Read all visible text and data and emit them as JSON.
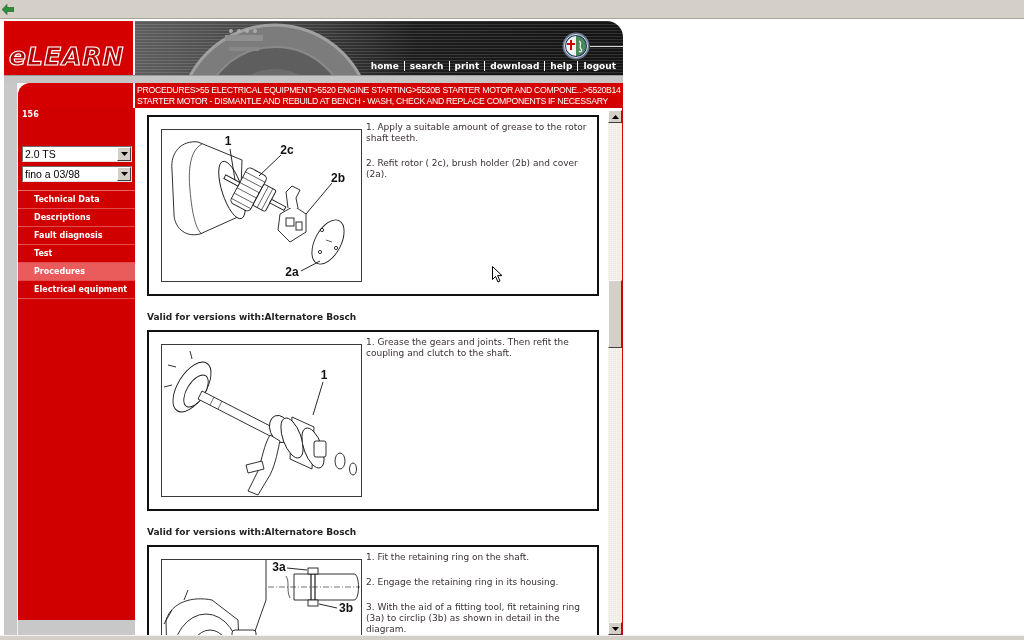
{
  "header": {
    "logo": "eLEARN",
    "nav_links": [
      "home",
      "search",
      "print",
      "download",
      "help",
      "logout"
    ]
  },
  "breadcrumb": {
    "lines": [
      "PROCEDURES>55 ELECTRICAL EQUIPMENT>5520 ENGINE STARTING>5520B STARTER MOTOR AND COMPONE...>5520B14",
      "STARTER MOTOR - DISMANTLE AND REBUILD AT BENCH - WASH, CHECK AND REPLACE COMPONENTS IF NECESSARY"
    ]
  },
  "sidebar": {
    "model": "156",
    "selects": [
      "2.0 TS",
      "fino a 03/98"
    ],
    "items": [
      {
        "label": "Technical Data",
        "selected": false
      },
      {
        "label": "Descriptions",
        "selected": false
      },
      {
        "label": "Fault diagnosis",
        "selected": false
      },
      {
        "label": "Test",
        "selected": false
      },
      {
        "label": "Procedures",
        "selected": true
      },
      {
        "label": "Electrical equipment",
        "selected": false
      }
    ]
  },
  "content": {
    "sections": [
      {
        "diagram": {
          "kind": "rotor-assembly",
          "callouts": [
            "1",
            "2c",
            "2b",
            "2a"
          ]
        },
        "steps": [
          "1. Apply a suitable amount of grease to the rotor shaft teeth.",
          "2. Refit rotor ( 2c), brush holder (2b) and cover (2a)."
        ]
      },
      {
        "heading": "Valid for versions with:Alternatore Bosch",
        "diagram": {
          "kind": "drive-pinion",
          "callouts": [
            "1"
          ]
        },
        "steps": [
          "1. Grease the gears and joints. Then refit the coupling and clutch to the shaft."
        ]
      },
      {
        "heading": "Valid for versions with:Alternatore Bosch",
        "diagram": {
          "kind": "retaining-ring",
          "callouts": [
            "3a",
            "3b"
          ]
        },
        "steps": [
          "1. Fit the retaining ring on the shaft.",
          "2. Engage the retaining ring in its housing.",
          "3. With the aid of a fitting tool, fit retaining ring (3a) to circlip (3b) as shown in detail in the diagram."
        ]
      }
    ]
  }
}
